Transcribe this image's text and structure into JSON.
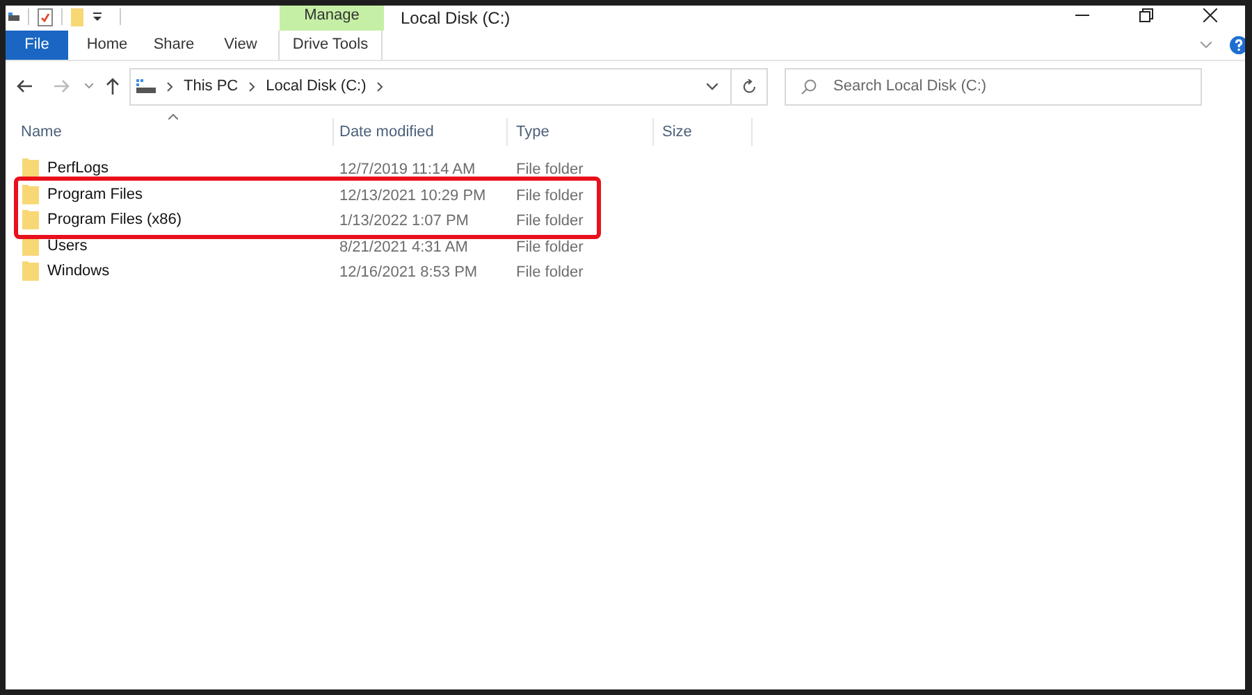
{
  "window": {
    "title": "Local Disk (C:)"
  },
  "ribbon": {
    "context_group": "Manage",
    "tabs": [
      {
        "label": "File",
        "kind": "file",
        "selected": false
      },
      {
        "label": "Home",
        "kind": "tab",
        "selected": false
      },
      {
        "label": "Share",
        "kind": "tab",
        "selected": false
      },
      {
        "label": "View",
        "kind": "tab",
        "selected": false
      },
      {
        "label": "Drive Tools",
        "kind": "context",
        "selected": false
      }
    ]
  },
  "address_bar": {
    "crumbs": [
      "This PC",
      "Local Disk (C:)"
    ]
  },
  "search": {
    "placeholder": "Search Local Disk (C:)"
  },
  "table": {
    "columns": [
      "Name",
      "Date modified",
      "Type",
      "Size"
    ],
    "rows": [
      {
        "name": "PerfLogs",
        "date": "12/7/2019 11:14 AM",
        "type": "File folder",
        "highlighted": false
      },
      {
        "name": "Program Files",
        "date": "12/13/2021 10:29 PM",
        "type": "File folder",
        "highlighted": true
      },
      {
        "name": "Program Files (x86)",
        "date": "1/13/2022 1:07 PM",
        "type": "File folder",
        "highlighted": true
      },
      {
        "name": "Users",
        "date": "8/21/2021 4:31 AM",
        "type": "File folder",
        "highlighted": false
      },
      {
        "name": "Windows",
        "date": "12/16/2021 8:53 PM",
        "type": "File folder",
        "highlighted": false
      }
    ]
  }
}
